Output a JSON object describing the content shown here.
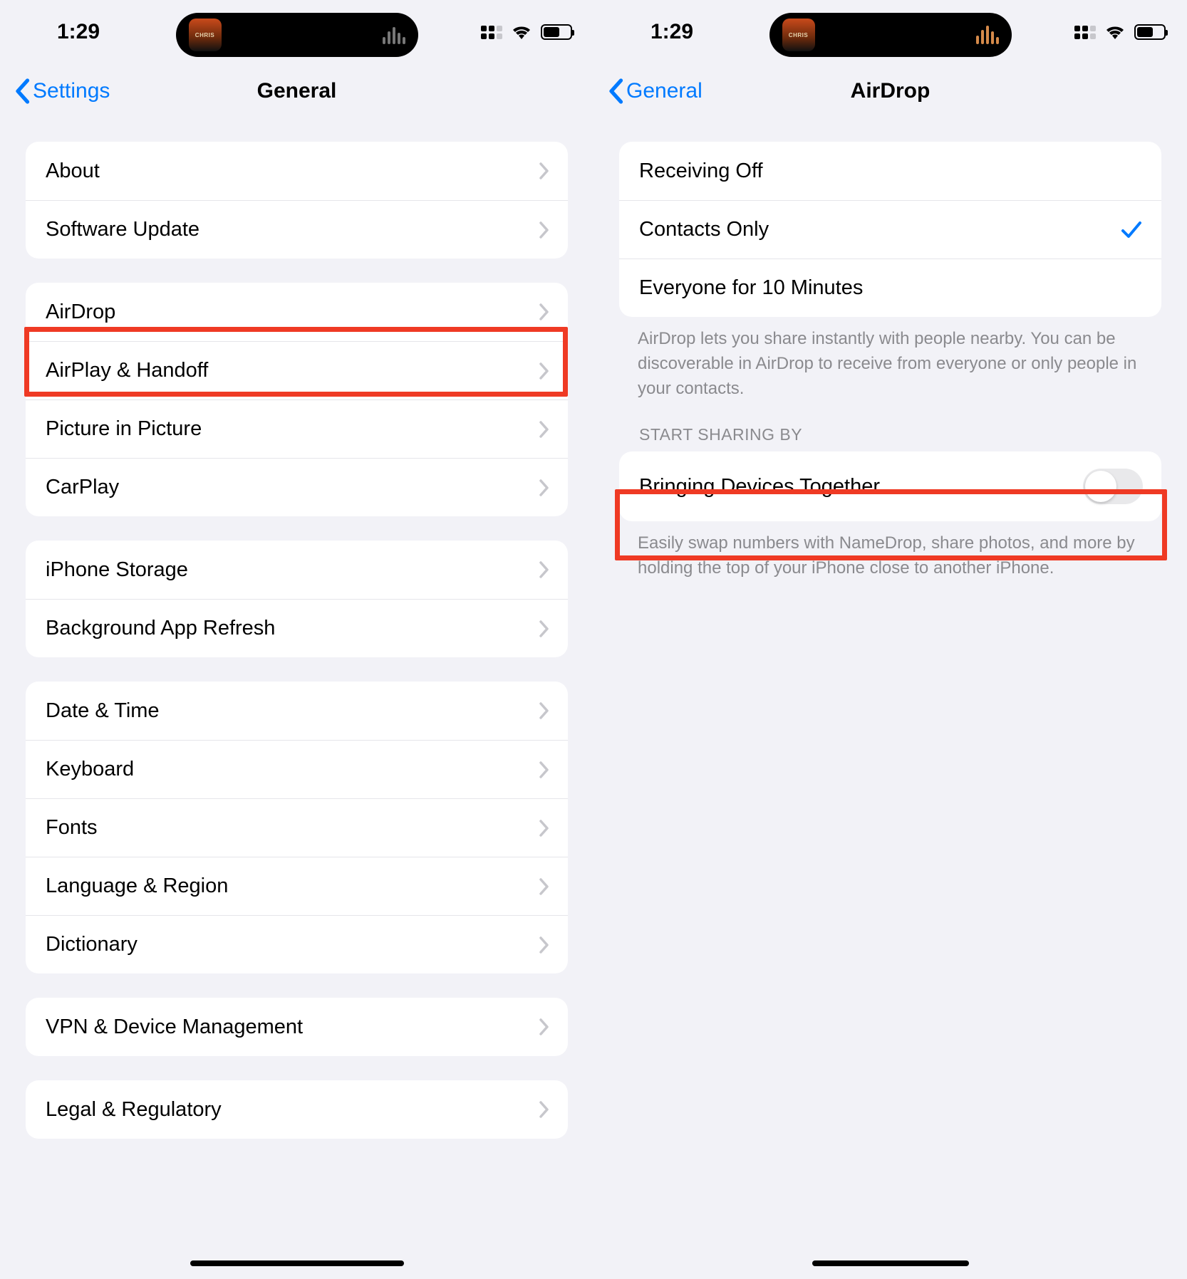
{
  "status": {
    "time": "1:29"
  },
  "left": {
    "back_label": "Settings",
    "title": "General",
    "groups": [
      {
        "items": [
          {
            "label": "About"
          },
          {
            "label": "Software Update"
          }
        ]
      },
      {
        "items": [
          {
            "label": "AirDrop",
            "highlighted": true
          },
          {
            "label": "AirPlay & Handoff"
          },
          {
            "label": "Picture in Picture"
          },
          {
            "label": "CarPlay"
          }
        ]
      },
      {
        "items": [
          {
            "label": "iPhone Storage"
          },
          {
            "label": "Background App Refresh"
          }
        ]
      },
      {
        "items": [
          {
            "label": "Date & Time"
          },
          {
            "label": "Keyboard"
          },
          {
            "label": "Fonts"
          },
          {
            "label": "Language & Region"
          },
          {
            "label": "Dictionary"
          }
        ]
      },
      {
        "items": [
          {
            "label": "VPN & Device Management"
          }
        ]
      },
      {
        "items": [
          {
            "label": "Legal & Regulatory"
          }
        ]
      }
    ]
  },
  "right": {
    "back_label": "General",
    "title": "AirDrop",
    "options": [
      {
        "label": "Receiving Off",
        "selected": false
      },
      {
        "label": "Contacts Only",
        "selected": true
      },
      {
        "label": "Everyone for 10 Minutes",
        "selected": false
      }
    ],
    "options_footer": "AirDrop lets you share instantly with people nearby. You can be discoverable in AirDrop to receive from everyone or only people in your contacts.",
    "section2_header": "START SHARING BY",
    "toggle_row": {
      "label": "Bringing Devices Together",
      "on": false,
      "highlighted": true
    },
    "toggle_footer": "Easily swap numbers with NameDrop, share photos, and more by holding the top of your iPhone close to another iPhone."
  }
}
